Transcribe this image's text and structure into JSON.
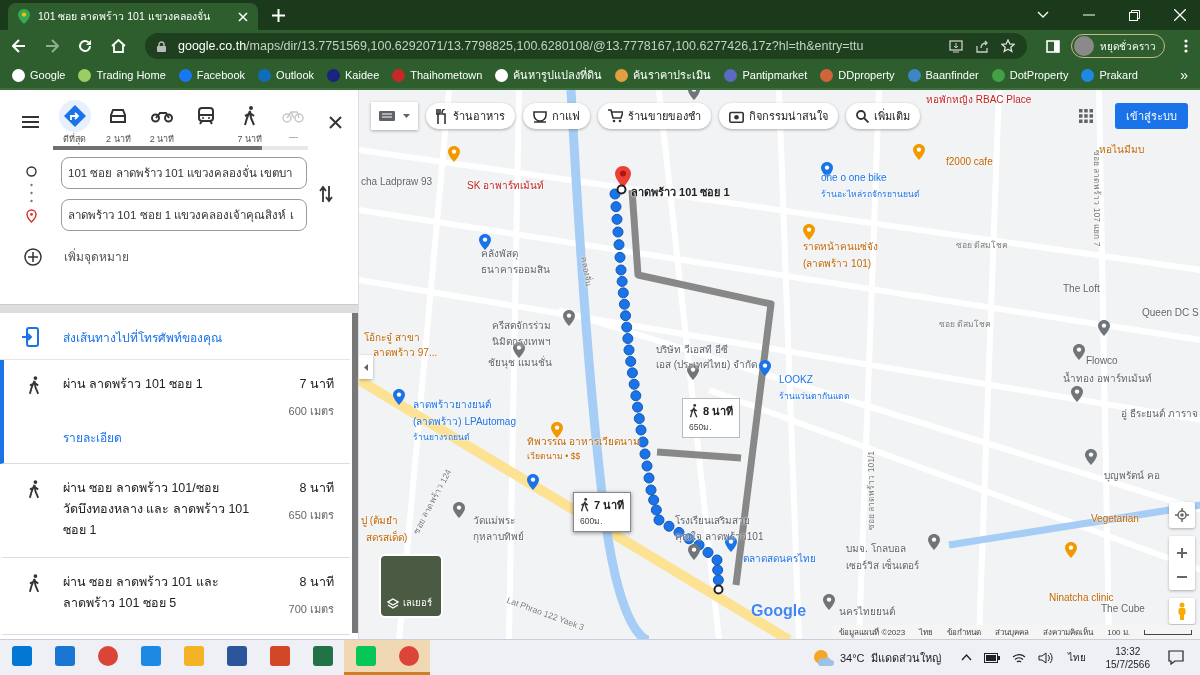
{
  "browser": {
    "tab_title": "101 ซอย ลาดพร้าว 101 แขวงคลองจั่น",
    "url_host": "google.co.th",
    "url_path": "/maps/dir/13.7751569,100.6292071/13.7798825,100.6280108/@13.7778167,100.6277426,17z?hl=th&entry=ttu",
    "profile_label": "หยุดชั่วคราว",
    "bookmarks": [
      {
        "label": "Google",
        "kind": "google"
      },
      {
        "label": "Trading Home",
        "kind": "trading"
      },
      {
        "label": "Facebook",
        "kind": "facebook"
      },
      {
        "label": "Outlook",
        "kind": "outlook"
      },
      {
        "label": "Kaidee",
        "kind": "kaidee"
      },
      {
        "label": "Thaihometown",
        "kind": "house"
      },
      {
        "label": "ค้นหารูปแปลงที่ดิน",
        "kind": "globe"
      },
      {
        "label": "ค้นราคาประเมิน",
        "kind": "seal"
      },
      {
        "label": "Pantipmarket",
        "kind": "pantip"
      },
      {
        "label": "DDproperty",
        "kind": "dd"
      },
      {
        "label": "Baanfinder",
        "kind": "baan"
      },
      {
        "label": "DotProperty",
        "kind": "dot"
      },
      {
        "label": "Prakard",
        "kind": "prakard"
      }
    ],
    "more_bookmarks": "»"
  },
  "directions": {
    "modes": [
      {
        "kind": "best",
        "label": "ดีที่สุด",
        "selected": true,
        "disabled": false
      },
      {
        "kind": "car",
        "label": "2 นาที",
        "selected": false,
        "disabled": false
      },
      {
        "kind": "motorbike",
        "label": "2 นาที",
        "selected": false,
        "disabled": false
      },
      {
        "kind": "transit",
        "selected": false,
        "disabled": false
      },
      {
        "kind": "walk",
        "label": "7 นาที",
        "selected": false,
        "disabled": false
      },
      {
        "kind": "bike",
        "label": "—",
        "selected": false,
        "disabled": true
      }
    ],
    "origin": "101 ซอย ลาดพร้าว 101 แขวงคลองจั่น เขตบา",
    "destination": "ลาดพร้าว 101 ซอย 1 แขวงคลองเจ้าคุณสิงห์ เ",
    "add_destination": "เพิ่มจุดหมาย",
    "send_to_phone": "ส่งเส้นทางไปที่โทรศัพท์ของคุณ",
    "routes": [
      {
        "via": "ผ่าน ลาดพร้าว 101 ซอย 1",
        "time": "7 นาที",
        "distance": "600 เมตร",
        "details": "รายละเอียด",
        "selected": true
      },
      {
        "via": "ผ่าน ซอย ลาดพร้าว 101/ซอย วัดบึงทองหลาง และ ลาดพร้าว 101 ซอย 1",
        "time": "8 นาที",
        "distance": "650 เมตร",
        "selected": false
      },
      {
        "via": "ผ่าน ซอย ลาดพร้าว 101 และ ลาดพร้าว 101 ซอย 5",
        "time": "8 นาที",
        "distance": "700 เมตร",
        "selected": false
      }
    ]
  },
  "map": {
    "chips": [
      {
        "kind": "food",
        "label": "ร้านอาหาร"
      },
      {
        "kind": "coffee",
        "label": "กาแฟ"
      },
      {
        "kind": "cart",
        "label": "ร้านขายของชำ"
      },
      {
        "kind": "camera",
        "label": "กิจกรรมน่าสนใจ"
      },
      {
        "kind": "search",
        "label": "เพิ่มเติม"
      }
    ],
    "sign_in": "เข้าสู่ระบบ",
    "layers": "เลเยอร์",
    "destination_label": "ลาดพร้าว 101 ซอย 1",
    "google_logo": "Google",
    "callouts": [
      {
        "time": "8 นาที",
        "distance": "650ม.",
        "selected": false
      },
      {
        "time": "7 นาที",
        "distance": "600ม.",
        "selected": true
      }
    ],
    "labels": [
      {
        "text": "หอพักหญิง RBAC Place",
        "kind": "lodging"
      },
      {
        "text": "หอไนมีมบ",
        "kind": "food"
      },
      {
        "text": "f2000 cafe",
        "kind": "food"
      },
      {
        "text": "cha Ladpraw 93",
        "kind": "place"
      },
      {
        "text": "SK อาพาร์ทเม้นท์",
        "kind": "lodging"
      },
      {
        "text": "one o one bike",
        "kind": "shop"
      },
      {
        "text": "ร้านอะไหล่รถจักรยานยนต์",
        "kind": "shop_sub"
      },
      {
        "text": "ราดหน้าคนแซ่จัง",
        "kind": "food"
      },
      {
        "text": "(ลาดพร้าว 101)",
        "kind": "food"
      },
      {
        "text": "คลังพัสดุ",
        "kind": "place"
      },
      {
        "text": "ธนาคารออมสิน",
        "kind": "place"
      },
      {
        "text": "The Loft",
        "kind": "place"
      },
      {
        "text": "Queen DC S",
        "kind": "place"
      },
      {
        "text": "โอ้กะจู๋ สาขา",
        "kind": "food"
      },
      {
        "text": "ลาดพร้าว 97...",
        "kind": "food"
      },
      {
        "text": "ครีสตจักรร่วม",
        "kind": "place"
      },
      {
        "text": "นิมิตกรุงเทพฯ",
        "kind": "place"
      },
      {
        "text": "ชัยนุช แมนชั่น",
        "kind": "place"
      },
      {
        "text": "บริษัท วีเอสที อีซี",
        "kind": "place"
      },
      {
        "text": "เอส (ประเทศไทย) จำกัด",
        "kind": "place"
      },
      {
        "text": "LOOKZ",
        "kind": "shop"
      },
      {
        "text": "ร้านแว่นตากันแดด",
        "kind": "shop_sub"
      },
      {
        "text": "Flowco",
        "kind": "place"
      },
      {
        "text": "น้ำทอง อพาร์ทเม้นท์",
        "kind": "place"
      },
      {
        "text": "อู่ ธีระยนต์ ภาราจ",
        "kind": "place"
      },
      {
        "text": "ลาดพร้าวยางยนต์",
        "kind": "shop"
      },
      {
        "text": "(ลาดพร้าว) LPAutomag",
        "kind": "shop"
      },
      {
        "text": "ร้านยางรถยนต์",
        "kind": "shop_sub"
      },
      {
        "text": "ทิพวรรณ อาหารเวียดนาม",
        "kind": "food"
      },
      {
        "text": "เวียดนาม • $$",
        "kind": "food_sub"
      },
      {
        "text": "บุญพรัตน์ คอ",
        "kind": "place"
      },
      {
        "text": "ปู (ต้มยำ",
        "kind": "food"
      },
      {
        "text": "สดรสเด็ด)",
        "kind": "food"
      },
      {
        "text": "วัดแม่พระ",
        "kind": "place"
      },
      {
        "text": "กุหลาบทิพย์",
        "kind": "place"
      },
      {
        "text": "โรงเรียนเสริมสวย",
        "kind": "place"
      },
      {
        "text": "คุณใจ ลาดพร้าว101",
        "kind": "place"
      },
      {
        "text": "Vegetarian",
        "kind": "food"
      },
      {
        "text": "ตลาดสดนครไทย",
        "kind": "shop"
      },
      {
        "text": "บมจ. โกลบอล",
        "kind": "place"
      },
      {
        "text": "เซอร์วิส เซ็นเตอร์",
        "kind": "place"
      },
      {
        "text": "นครไทยยนต์",
        "kind": "place"
      },
      {
        "text": "Ninatcha clinic",
        "kind": "food"
      },
      {
        "text": "The Cube",
        "kind": "place"
      },
      {
        "text": "ซอย ดีสมโชค",
        "kind": "street"
      },
      {
        "text": "ซอย ดีสมโชค",
        "kind": "street"
      },
      {
        "text": "ซอย ลาดพร้าว 107 แยก 7",
        "kind": "street"
      },
      {
        "text": "ซอย ลาดพร้าว 101/1",
        "kind": "street"
      },
      {
        "text": "ซอย ลาดพร้าว 124",
        "kind": "street"
      },
      {
        "text": "Lat Phrao 122 Yaek 3",
        "kind": "street"
      },
      {
        "text": "คลองจั่น",
        "kind": "street"
      }
    ],
    "footer": [
      "ข้อมูลแผนที่ ©2023",
      "ไทย",
      "ข้อกำหนด",
      "ส่วนบุคคล",
      "ส่งความคิดเห็น",
      "100 ม."
    ]
  },
  "taskbar": {
    "apps": [
      {
        "kind": "start",
        "selected": false
      },
      {
        "kind": "mail",
        "selected": false
      },
      {
        "kind": "chrome",
        "selected": false
      },
      {
        "kind": "edge",
        "selected": false
      },
      {
        "kind": "files",
        "selected": false
      },
      {
        "kind": "word",
        "selected": false
      },
      {
        "kind": "powerpoint",
        "selected": false
      },
      {
        "kind": "excel",
        "selected": false
      },
      {
        "kind": "line",
        "selected": true
      },
      {
        "kind": "chrome",
        "selected": true
      }
    ],
    "temperature": "34°C",
    "weather": "มีแดดส่วนใหญ่",
    "language": "ไทย",
    "time": "13:32",
    "date": "15/7/2566"
  }
}
